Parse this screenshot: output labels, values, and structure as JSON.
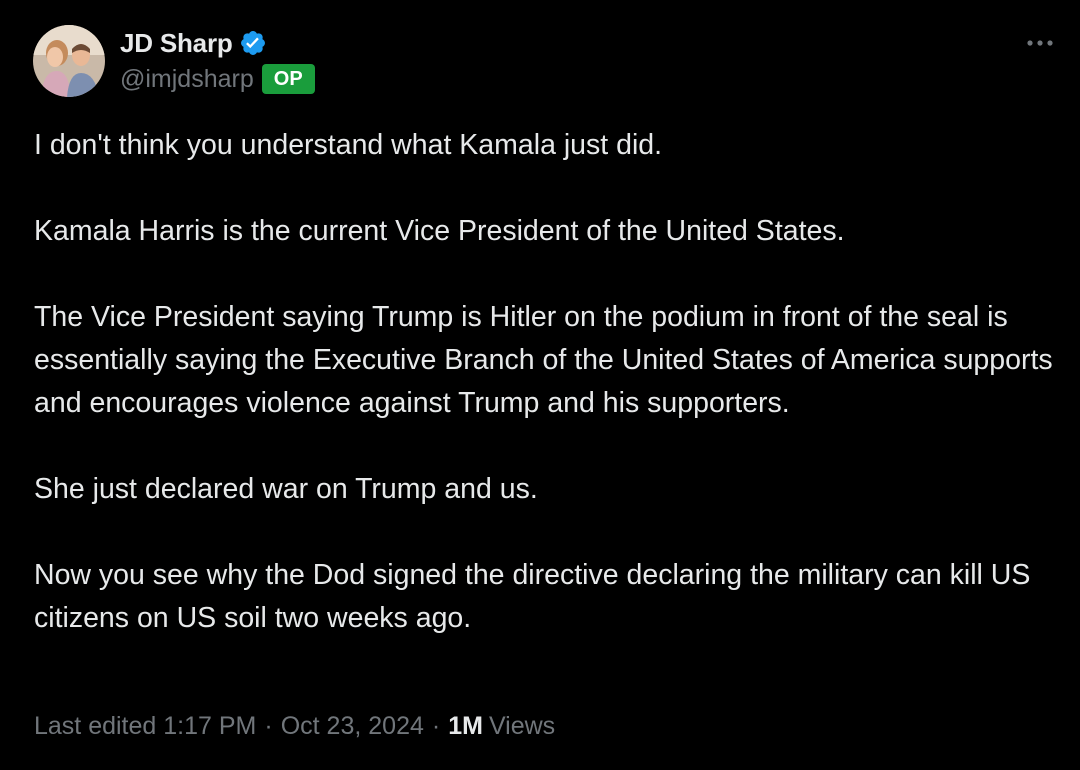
{
  "author": {
    "display_name": "JD Sharp",
    "handle": "@imjdsharp",
    "badge": "OP",
    "verified_color": "#1d9bf0",
    "badge_color": "#1a9d3c"
  },
  "more_icon": "more-horizontal-icon",
  "tweet": {
    "paragraphs": [
      "I don't think you understand what Kamala just did.",
      "Kamala Harris is the current Vice President of the United States.",
      "The Vice President saying Trump is Hitler on the podium in front of the seal is essentially saying the Executive Branch of the United States of America supports and encourages violence against Trump and his supporters.",
      "She just declared war on Trump and us.",
      "Now you see why the Dod signed the directive declaring the military can kill US citizens on US soil two weeks ago."
    ]
  },
  "meta": {
    "edited_label": "Last edited",
    "time": "1:17 PM",
    "date": "Oct 23, 2024",
    "views_count": "1M",
    "views_label": "Views",
    "separator": "·"
  }
}
